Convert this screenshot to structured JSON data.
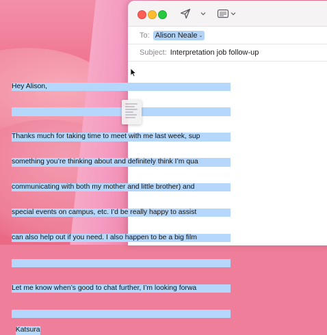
{
  "compose": {
    "to_label": "To:",
    "recipient": "Alison Neale",
    "subject_label": "Subject:",
    "subject": "Interpretation job follow-up"
  },
  "body": {
    "lines": [
      "Hey Alison,",
      "",
      "Thanks much for taking time to meet with me last week, sup",
      "something you’re thinking about and definitely think I’m qua",
      "communicating with both my mother and little brother) and",
      "special events on campus, etc. I’d be really happy to assist",
      "can also help out if you need. I also happen to be a big film",
      "",
      "Let me know when’s good to chat further, I’m looking forwa",
      "",
      "Katsura"
    ]
  },
  "colors": {
    "selection": "#b4d7fb",
    "recipient_token": "#b3d3f6",
    "close": "#fe5f57",
    "minimize": "#febc2e",
    "zoom": "#28c840"
  },
  "icons": {
    "send": "paper-plane-icon",
    "format": "message-format-icon",
    "cursor": "arrow-cursor-icon"
  }
}
